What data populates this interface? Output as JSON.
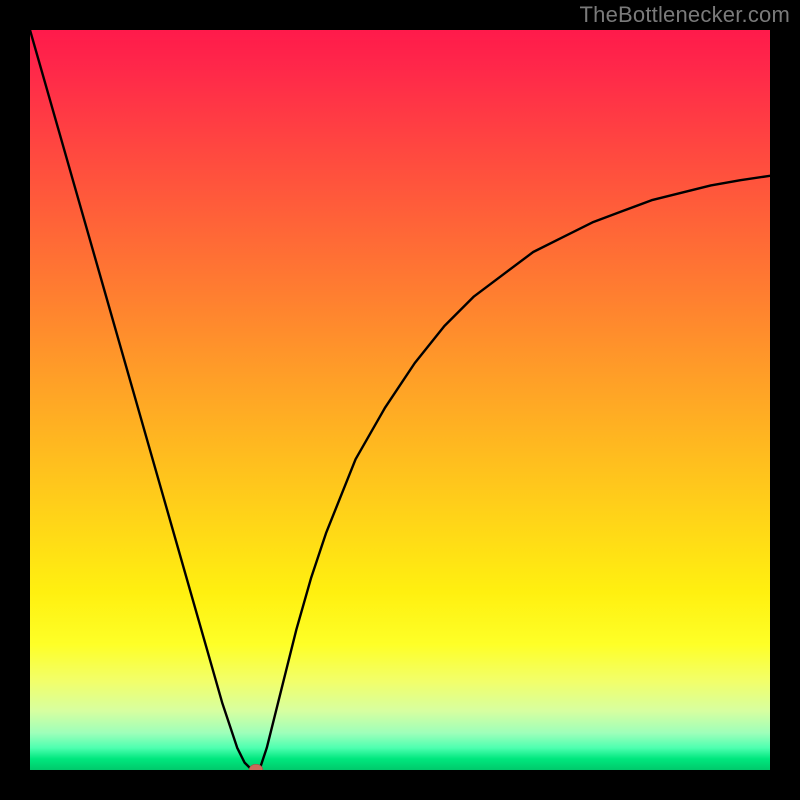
{
  "attribution": "TheBottlenecker.com",
  "colors": {
    "page_bg": "#000000",
    "curve_stroke": "#000000",
    "marker_fill": "#cc6b5a",
    "gradient_top": "#ff1a4b",
    "gradient_bottom": "#00c96b"
  },
  "chart_data": {
    "type": "line",
    "title": "",
    "xlabel": "",
    "ylabel": "",
    "xlim": [
      0,
      100
    ],
    "ylim": [
      0,
      100
    ],
    "x": [
      0,
      2,
      4,
      6,
      8,
      10,
      12,
      14,
      16,
      18,
      20,
      22,
      24,
      26,
      28,
      29,
      30,
      31,
      32,
      34,
      36,
      38,
      40,
      44,
      48,
      52,
      56,
      60,
      64,
      68,
      72,
      76,
      80,
      84,
      88,
      92,
      96,
      100
    ],
    "values": [
      100,
      93,
      86,
      79,
      72,
      65,
      58,
      51,
      44,
      37,
      30,
      23,
      16,
      9,
      3,
      1,
      0,
      0,
      3,
      11,
      19,
      26,
      32,
      42,
      49,
      55,
      60,
      64,
      67,
      70,
      72,
      74,
      75.5,
      77,
      78,
      79,
      79.7,
      80.3
    ],
    "marker": {
      "x": 30.5,
      "y": 0
    },
    "grid": false,
    "legend": false
  }
}
